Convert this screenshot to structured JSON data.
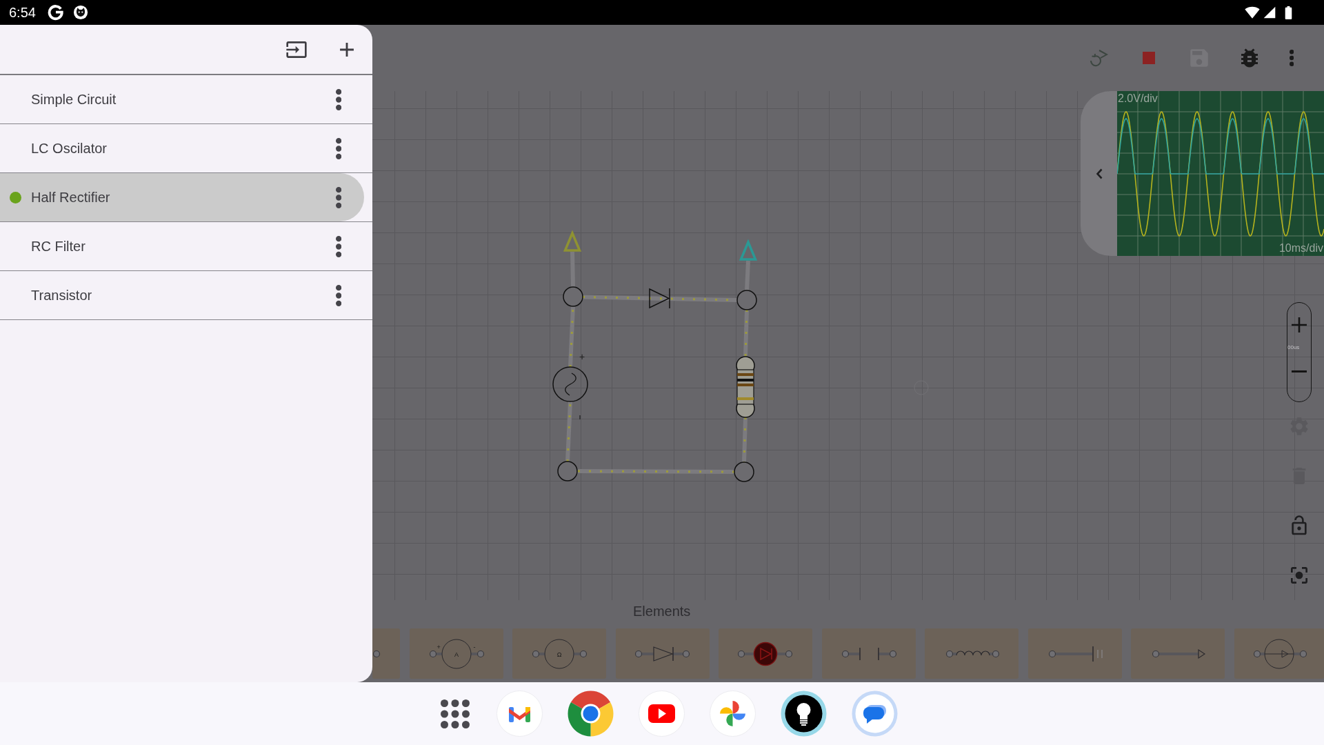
{
  "status_bar": {
    "time": "6:54"
  },
  "drawer": {
    "circuits": [
      {
        "name": "Simple Circuit",
        "selected": false,
        "running": false
      },
      {
        "name": "LC Oscilator",
        "selected": false,
        "running": false
      },
      {
        "name": "Half Rectifier",
        "selected": true,
        "running": true
      },
      {
        "name": "RC Filter",
        "selected": false,
        "running": false
      },
      {
        "name": "Transistor",
        "selected": false,
        "running": false
      }
    ]
  },
  "toolbar": {
    "actions": [
      {
        "kind": "restart",
        "disabled": false
      },
      {
        "kind": "stop",
        "disabled": false
      },
      {
        "kind": "save",
        "disabled": true
      },
      {
        "kind": "debug",
        "disabled": false
      },
      {
        "kind": "more",
        "disabled": false
      }
    ]
  },
  "oscilloscope": {
    "volts_per_div": "2.0V/div",
    "time_per_div": "10ms/div",
    "traces": [
      {
        "color": "#b5b31e"
      },
      {
        "color": "#2fa39e"
      }
    ]
  },
  "zoom_control": {
    "label": "00us"
  },
  "side_tools": [
    {
      "kind": "settings",
      "disabled": true
    },
    {
      "kind": "delete",
      "disabled": true
    },
    {
      "kind": "lock",
      "disabled": false
    },
    {
      "kind": "focus",
      "disabled": false
    }
  ],
  "circuit": {
    "polarity_label": "+",
    "probes": [
      {
        "color": "#8f9232"
      },
      {
        "color": "#2b9995"
      }
    ]
  },
  "elements": {
    "title": "Elements",
    "items": [
      {
        "kind": "terminal"
      },
      {
        "kind": "ammeter",
        "symbol": "A",
        "plus": "+",
        "minus": "-"
      },
      {
        "kind": "ohmmeter",
        "symbol": "Ω"
      },
      {
        "kind": "diode"
      },
      {
        "kind": "led"
      },
      {
        "kind": "capacitor"
      },
      {
        "kind": "inductor"
      },
      {
        "kind": "battery"
      },
      {
        "kind": "probe"
      },
      {
        "kind": "current_source"
      }
    ]
  }
}
